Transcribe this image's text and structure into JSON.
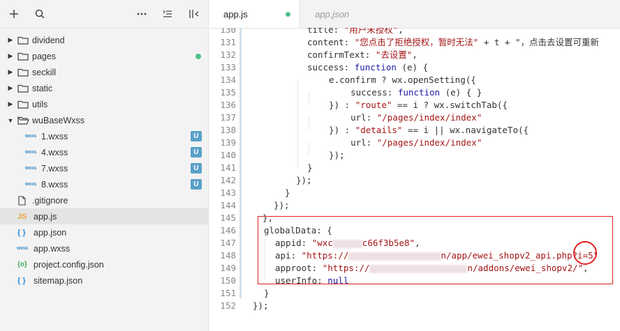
{
  "sidebar": {
    "toolbar": {
      "add_icon": "plus-icon",
      "search_icon": "search-icon",
      "more_icon": "ellipsis-icon",
      "sort_icon": "sort-icon",
      "split_icon": "split-icon"
    },
    "tree": [
      {
        "label": "dividend",
        "kind": "folder",
        "open": false
      },
      {
        "label": "pages",
        "kind": "folder",
        "open": false,
        "modified_dot": true
      },
      {
        "label": "seckill",
        "kind": "folder",
        "open": false
      },
      {
        "label": "static",
        "kind": "folder",
        "open": false
      },
      {
        "label": "utils",
        "kind": "folder",
        "open": false
      },
      {
        "label": "wuBaseWxss",
        "kind": "folder",
        "open": true
      },
      {
        "label": "1.wxss",
        "kind": "wxss",
        "badge": "U"
      },
      {
        "label": "4.wxss",
        "kind": "wxss",
        "badge": "U"
      },
      {
        "label": "7.wxss",
        "kind": "wxss",
        "badge": "U"
      },
      {
        "label": "8.wxss",
        "kind": "wxss",
        "badge": "U"
      },
      {
        "label": ".gitignore",
        "kind": "file"
      },
      {
        "label": "app.js",
        "kind": "js",
        "active": true
      },
      {
        "label": "app.json",
        "kind": "json"
      },
      {
        "label": "app.wxss",
        "kind": "wxss"
      },
      {
        "label": "project.config.json",
        "kind": "config"
      },
      {
        "label": "sitemap.json",
        "kind": "json"
      }
    ],
    "icon_tags": {
      "wxss": "wxss",
      "js": "JS",
      "json": "{ }",
      "config": "{o}"
    }
  },
  "editor": {
    "tabs": [
      {
        "label": "app.js",
        "active": true,
        "modified": true
      },
      {
        "label": "app.json",
        "active": false
      }
    ],
    "lines": [
      {
        "n": "130",
        "text": "title: \"用户未授权\","
      },
      {
        "n": "131",
        "text": "content: \"您点击了拒绝授权，暂时无法\" + t + \"，点击去设置可重新"
      },
      {
        "n": "132",
        "text": "confirmText: \"去设置\","
      },
      {
        "n": "133",
        "text": "success: function (e) {"
      },
      {
        "n": "134",
        "text": "  e.confirm ? wx.openSetting({"
      },
      {
        "n": "135",
        "text": "    success: function (e) { }"
      },
      {
        "n": "136",
        "text": "  }) : \"route\" == i ? wx.switchTab({"
      },
      {
        "n": "137",
        "text": "    url: \"/pages/index/index\""
      },
      {
        "n": "138",
        "text": "  }) : \"details\" == i || wx.navigateTo({"
      },
      {
        "n": "139",
        "text": "    url: \"/pages/index/index\""
      },
      {
        "n": "140",
        "text": "  });"
      },
      {
        "n": "141",
        "text": "}"
      },
      {
        "n": "142",
        "text": "});"
      },
      {
        "n": "143",
        "text": "}"
      },
      {
        "n": "144",
        "text": "});"
      },
      {
        "n": "145",
        "text": "},"
      },
      {
        "n": "146",
        "text": "globalData: {"
      },
      {
        "n": "147",
        "text": "appid: \"wxc"
      },
      {
        "n": "148",
        "text": "api: \"https://"
      },
      {
        "n": "149",
        "text": "approot: \"https://"
      },
      {
        "n": "150",
        "text": "userInfo: null"
      },
      {
        "n": "151",
        "text": "}"
      },
      {
        "n": "152",
        "text": "});"
      }
    ],
    "fragments": {
      "appid_prefix": "appid: ",
      "appid_open": "\"wxc",
      "appid_close": "c66f3b5e8\"",
      "api_prefix": "api: ",
      "api_open": "\"https://",
      "api_mid": "n/app/ewei_shopv2_api.php?i=5\"",
      "approot_prefix": "approot: ",
      "approot_open": "\"https://",
      "approot_mid": "n/addons/ewei_shopv2/\"",
      "comma": ",",
      "userinfo_key": "userInfo: ",
      "null_kw": "null"
    }
  },
  "colors": {
    "keyword": "#1a1aa6",
    "string": "#a31515",
    "annotation": "#e02020",
    "badge": "#5aa0c8",
    "dot": "#4ec08b"
  }
}
